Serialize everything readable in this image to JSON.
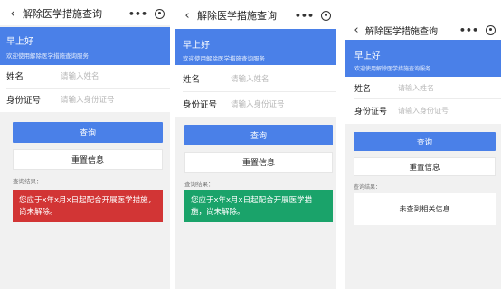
{
  "screens": [
    {
      "nav": {
        "back_icon": "‹",
        "title": "解除医学措施查询",
        "more": "•••"
      },
      "banner": {
        "greeting": "早上好",
        "welcome": "欢迎使用解除医学措施查询服务"
      },
      "form": {
        "name_label": "姓名",
        "name_placeholder": "请输入姓名",
        "id_label": "身份证号",
        "id_placeholder": "请输入身份证号"
      },
      "buttons": {
        "query": "查询",
        "reset": "重置信息"
      },
      "result": {
        "label": "查询结果：",
        "text": "您应于x年x月x日起配合开展医学措施，尚未解除。",
        "color": "#d23535"
      }
    },
    {
      "nav": {
        "back_icon": "‹",
        "title": "解除医学措施查询",
        "more": "•••"
      },
      "banner": {
        "greeting": "早上好",
        "welcome": "欢迎使用解除医学措施查询服务"
      },
      "form": {
        "name_label": "姓名",
        "name_placeholder": "请输入姓名",
        "id_label": "身份证号",
        "id_placeholder": "请输入身份证号"
      },
      "buttons": {
        "query": "查询",
        "reset": "重置信息"
      },
      "result": {
        "label": "查询结果：",
        "text": "您应于x年x月x日起配合开展医学措施，尚未解除。",
        "color": "#1aa36a"
      }
    },
    {
      "nav": {
        "back_icon": "‹",
        "title": "解除医学措施查询",
        "more": "•••"
      },
      "banner": {
        "greeting": "早上好",
        "welcome": "欢迎使用解除医学措施查询服务"
      },
      "form": {
        "name_label": "姓名",
        "name_placeholder": "请输入姓名",
        "id_label": "身份证号",
        "id_placeholder": "请输入身份证号"
      },
      "buttons": {
        "query": "查询",
        "reset": "重置信息"
      },
      "result": {
        "label": "查询结果：",
        "text": "未查到相关信息",
        "color": "#ffffff"
      }
    }
  ],
  "colors": {
    "accent": "#4a80e8",
    "danger": "#d23535",
    "success": "#1aa36a"
  }
}
